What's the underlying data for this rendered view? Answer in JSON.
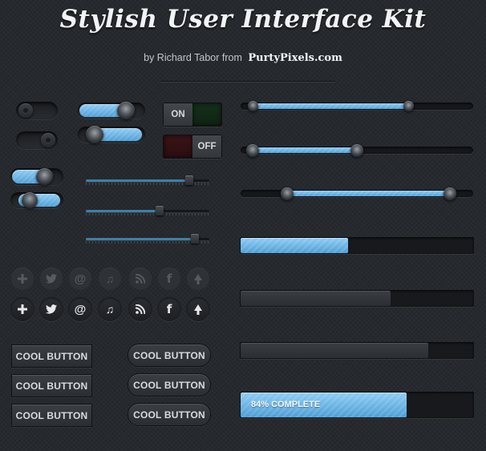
{
  "header": {
    "title": "Stylish User Interface Kit",
    "byline": "by Richard Tabor from",
    "brand": "PurtyPixels.com"
  },
  "switches": {
    "on_label": "ON",
    "off_label": "OFF"
  },
  "toggles": [
    {
      "state": "off"
    },
    {
      "state": "off"
    },
    {
      "state": "on"
    },
    {
      "state": "on"
    },
    {
      "state": "on"
    },
    {
      "state": "on"
    }
  ],
  "small_sliders": [
    0.84,
    0.6,
    0.88
  ],
  "range_sliders": [
    {
      "low": 0.05,
      "high": 0.72
    },
    {
      "low": 0.05,
      "high": 0.5
    },
    {
      "low": 0.2,
      "high": 0.9
    }
  ],
  "progress_bars": [
    {
      "value": 0.46,
      "style": "blue"
    },
    {
      "value": 0.64,
      "style": "dark"
    },
    {
      "value": 0.8,
      "style": "dark"
    },
    {
      "value": 0.71,
      "style": "blue",
      "label": "84% COMPLETE"
    }
  ],
  "social_icons": [
    "plus-icon",
    "twitter-icon",
    "at-icon",
    "music-icon",
    "rss-icon",
    "facebook-icon",
    "tree-icon"
  ],
  "buttons": {
    "square": [
      "COOL BUTTON",
      "COOL BUTTON",
      "COOL BUTTON"
    ],
    "rounded": [
      "COOL BUTTON",
      "COOL BUTTON",
      "COOL BUTTON"
    ]
  },
  "colors": {
    "background": "#26292d",
    "accent_blue": "#6ab4e6",
    "switch_on": "#14301a",
    "switch_off": "#3a1416"
  }
}
